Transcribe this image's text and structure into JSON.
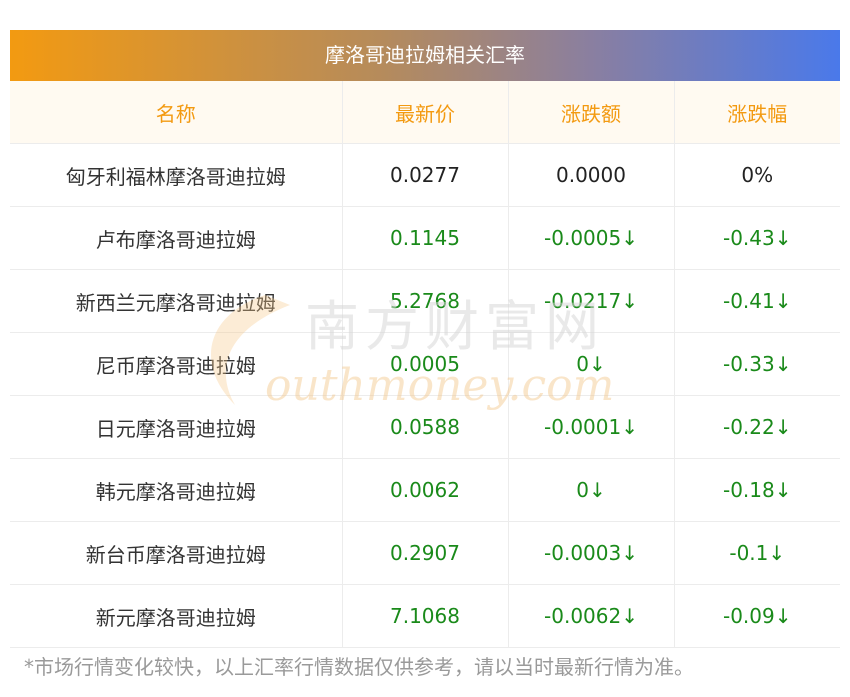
{
  "title": "摩洛哥迪拉姆相关汇率",
  "headers": [
    "名称",
    "最新价",
    "涨跌额",
    "涨跌幅"
  ],
  "rows": [
    {
      "name": "匈牙利福林摩洛哥迪拉姆",
      "price": "0.0277",
      "change": "0.0000",
      "pct": "0%",
      "trend": "flat"
    },
    {
      "name": "卢布摩洛哥迪拉姆",
      "price": "0.1145",
      "change": "-0.0005↓",
      "pct": "-0.43↓",
      "trend": "down"
    },
    {
      "name": "新西兰元摩洛哥迪拉姆",
      "price": "5.2768",
      "change": "-0.0217↓",
      "pct": "-0.41↓",
      "trend": "down"
    },
    {
      "name": "尼币摩洛哥迪拉姆",
      "price": "0.0005",
      "change": "0↓",
      "pct": "-0.33↓",
      "trend": "down"
    },
    {
      "name": "日元摩洛哥迪拉姆",
      "price": "0.0588",
      "change": "-0.0001↓",
      "pct": "-0.22↓",
      "trend": "down"
    },
    {
      "name": "韩元摩洛哥迪拉姆",
      "price": "0.0062",
      "change": "0↓",
      "pct": "-0.18↓",
      "trend": "down"
    },
    {
      "name": "新台币摩洛哥迪拉姆",
      "price": "0.2907",
      "change": "-0.0003↓",
      "pct": "-0.1↓",
      "trend": "down"
    },
    {
      "name": "新元摩洛哥迪拉姆",
      "price": "7.1068",
      "change": "-0.0062↓",
      "pct": "-0.09↓",
      "trend": "down"
    }
  ],
  "footnote": "*市场行情变化较快，以上汇率行情数据仅供参考，请以当时最新行情为准。",
  "watermark": {
    "cn": "南方财富网",
    "en": "outhmoney.com"
  },
  "colors": {
    "header_text": "#f39a11",
    "down": "#1a8a1a",
    "gradient_start": "#f39a11",
    "gradient_end": "#4a79ea"
  }
}
